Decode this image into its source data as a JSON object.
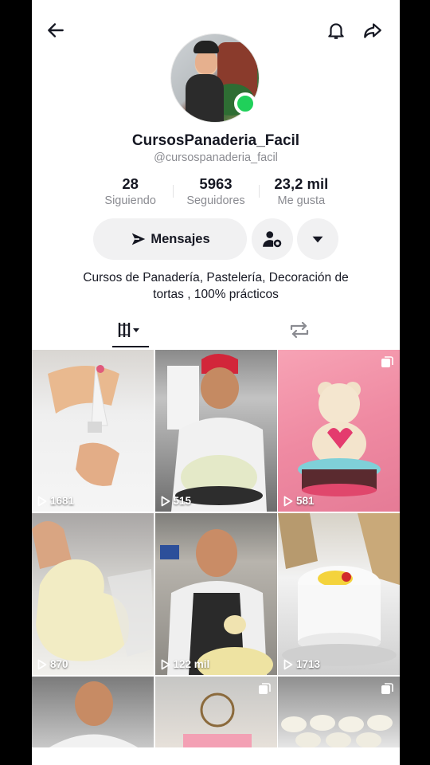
{
  "profile": {
    "username": "CursosPanaderia_Facil",
    "handle": "@cursospanaderia_facil",
    "online": true
  },
  "stats": [
    {
      "value": "28",
      "label": "Siguiendo"
    },
    {
      "value": "5963",
      "label": "Seguidores"
    },
    {
      "value": "23,2 mil",
      "label": "Me gusta"
    }
  ],
  "actions": {
    "message_label": "Mensajes"
  },
  "bio": {
    "line1": "Cursos de Panadería, Pastelería, Decoración de",
    "line2": "tortas , 100% prácticos"
  },
  "tabs": [
    {
      "icon": "videos-grid-icon",
      "active": true
    },
    {
      "icon": "repost-icon",
      "active": false
    }
  ],
  "videos": [
    {
      "views": "1681",
      "multi": false
    },
    {
      "views": "515",
      "multi": false
    },
    {
      "views": "581",
      "multi": true
    },
    {
      "views": "870",
      "multi": false
    },
    {
      "views": "122 mil",
      "multi": false
    },
    {
      "views": "1713",
      "multi": false
    },
    {
      "views": "",
      "multi": false
    },
    {
      "views": "",
      "multi": true
    },
    {
      "views": "",
      "multi": true
    }
  ],
  "colors": {
    "online": "#20d05a",
    "button_bg": "#f1f1f2",
    "text_primary": "#161823",
    "text_secondary": "#8a8b91"
  }
}
